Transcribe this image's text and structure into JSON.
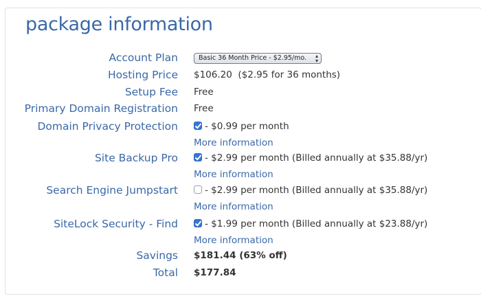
{
  "title": "package information",
  "account_plan": {
    "label": "Account Plan",
    "selected": "Basic 36 Month Price - $2.95/mo."
  },
  "hosting_price": {
    "label": "Hosting Price",
    "value": "$106.20",
    "detail": "($2.95 for 36 months)"
  },
  "setup_fee": {
    "label": "Setup Fee",
    "value": "Free"
  },
  "primary_domain": {
    "label": "Primary Domain Registration",
    "value": "Free"
  },
  "addons": [
    {
      "label": "Domain Privacy Protection",
      "checked": true,
      "price": "- $0.99 per month",
      "more": "More information"
    },
    {
      "label": "Site Backup Pro",
      "checked": true,
      "price": "- $2.99 per month (Billed annually at $35.88/yr)",
      "more": "More information"
    },
    {
      "label": "Search Engine Jumpstart",
      "checked": false,
      "price": "- $2.99 per month (Billed annually at $35.88/yr)",
      "more": "More information"
    },
    {
      "label": "SiteLock Security - Find",
      "checked": true,
      "price": "- $1.99 per month (Billed annually at $23.88/yr)",
      "more": "More information"
    }
  ],
  "savings": {
    "label": "Savings",
    "value": "$181.44 (63% off)"
  },
  "total": {
    "label": "Total",
    "value": "$177.84"
  }
}
